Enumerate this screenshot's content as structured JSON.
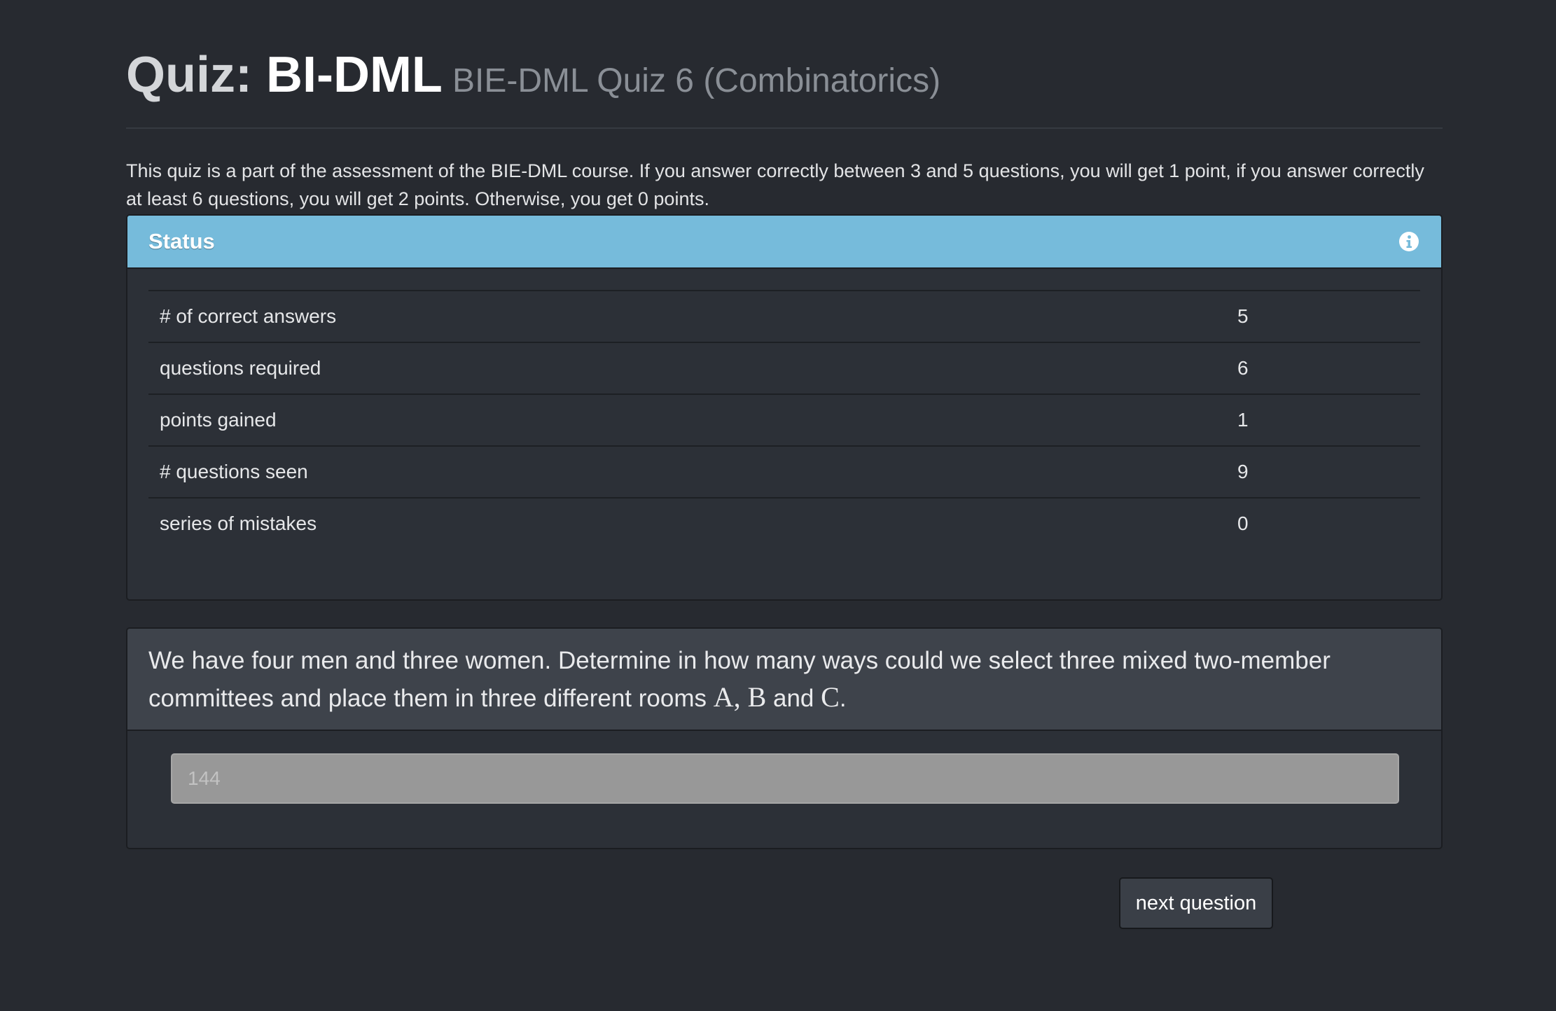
{
  "header": {
    "title_prefix": "Quiz:",
    "title_main": "BI-DML",
    "subtitle": "BIE-DML Quiz 6 (Combinatorics)"
  },
  "intro": "This quiz is a part of the assessment of the BIE-DML course. If you answer correctly between 3 and 5 questions, you will get 1 point, if you answer correctly at least 6 questions, you will get 2 points. Otherwise, you get 0 points.",
  "status": {
    "title": "Status",
    "info_icon": "info-circle-icon",
    "accent_color": "#76bbdb",
    "rows": [
      {
        "label": "# of correct answers",
        "value": "5"
      },
      {
        "label": "questions required",
        "value": "6"
      },
      {
        "label": "points gained",
        "value": "1"
      },
      {
        "label": "# questions seen",
        "value": "9"
      },
      {
        "label": "series of mistakes",
        "value": "0"
      }
    ]
  },
  "question": {
    "text_before": "We have four men and three women. Determine in how many ways could we select three mixed two-member committees and place them in three different rooms ",
    "math_rooms": "A, B",
    "text_and": " and ",
    "math_last": "C",
    "text_end": ".",
    "answer_value": "144"
  },
  "actions": {
    "next_label": "next question"
  }
}
